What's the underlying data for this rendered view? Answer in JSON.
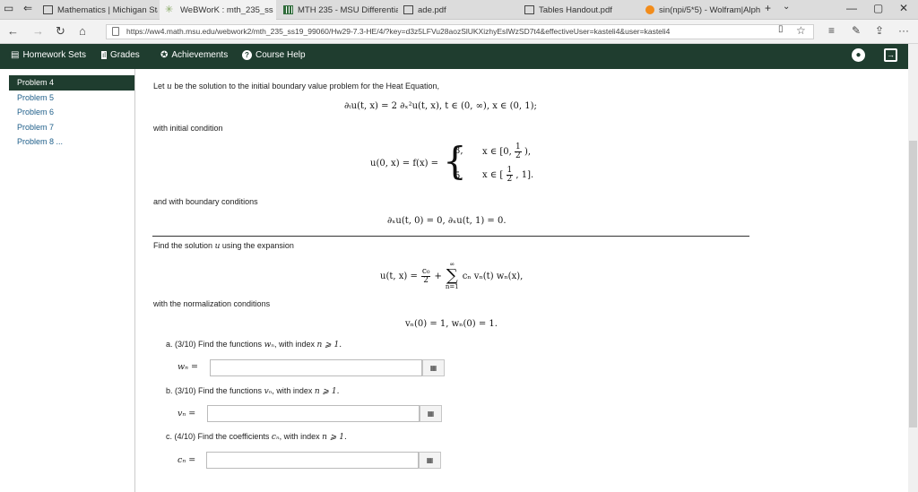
{
  "browser": {
    "tabs": [
      {
        "label": "Mathematics | Michigan Sta",
        "icon": "page-icon"
      },
      {
        "label": "WeBWorK : mth_235_ss",
        "icon": "webwork-star-icon",
        "active": true
      },
      {
        "label": "MTH 235 - MSU Differentia",
        "icon": "grid-icon"
      },
      {
        "label": "ade.pdf",
        "icon": "page-icon"
      },
      {
        "label": "Tables Handout.pdf",
        "icon": "page-icon"
      },
      {
        "label": "sin(npi/5*5) - Wolfram|Alph",
        "icon": "wolfram-icon"
      }
    ],
    "url": "https://ww4.math.msu.edu/webwork2/mth_235_ss19_99060/Hw29-7.3-HE/4/?key=d3z5LFVu28aozSlUKXizhyEsIWzSD7t4&effectiveUser=kasteli4&user=kasteli4"
  },
  "appnav": {
    "homework_sets": "Homework Sets",
    "grades": "Grades",
    "achievements": "Achievements",
    "course_help": "Course Help"
  },
  "sidebar": {
    "items": [
      "Problem 4",
      "Problem 5",
      "Problem 6",
      "Problem 7",
      "Problem 8 ..."
    ]
  },
  "problem": {
    "intro_pre": "Let",
    "intro_var": "u",
    "intro_post": "be the solution to the initial boundary value problem for the Heat Equation,",
    "heat_eq": "∂ₜu(t, x) = 2 ∂ₓ²u(t, x),    t ∈ (0, ∞),    x ∈ (0, 1);",
    "initial_label": "with initial condition",
    "ic_lhs": "u(0, x) = f(x) =",
    "ic_case1_val": "3,",
    "ic_case1_dom_pre": "x ∈ [0,",
    "ic_case1_dom_num": "1",
    "ic_case1_dom_den": "2",
    "ic_case1_dom_post": "),",
    "ic_case2_val": "5,",
    "ic_case2_dom_pre": "x ∈ [",
    "ic_case2_dom_num": "1",
    "ic_case2_dom_den": "2",
    "ic_case2_dom_post": ", 1].",
    "boundary_label": "and with boundary conditions",
    "bc_eq": "∂ₓu(t, 0) = 0,    ∂ₓu(t, 1) = 0.",
    "expansion_label_pre": "Find the solution",
    "expansion_label_var": "u",
    "expansion_label_post": "using the expansion",
    "expansion_lhs": "u(t, x) =",
    "expansion_c0_num": "c₀",
    "expansion_c0_den": "2",
    "expansion_plus": "+",
    "expansion_sum_top": "∞",
    "expansion_sum_bot": "n=1",
    "expansion_rhs": "cₙ vₙ(t) wₙ(x),",
    "norm_label": "with the normalization conditions",
    "norm_eq": "vₙ(0) = 1,    wₙ(0) = 1.",
    "parts": [
      {
        "label_pre": "a.  (3/10) Find the functions",
        "label_var": "wₙ",
        "label_post": ", with index",
        "label_cond": "n ⩾ 1.",
        "input_label": "wₙ ="
      },
      {
        "label_pre": "b.  (3/10) Find the functions",
        "label_var": "vₙ",
        "label_post": ", with index",
        "label_cond": "n ⩾ 1.",
        "input_label": "vₙ ="
      },
      {
        "label_pre": "c.  (4/10) Find the coefficients",
        "label_var": "cₙ",
        "label_post": ", with index",
        "label_cond": "n ⩾ 1.",
        "input_label": "cₙ ="
      }
    ]
  },
  "colors": {
    "nav_bg": "#1f3d2f",
    "link": "#1f5f8a"
  }
}
